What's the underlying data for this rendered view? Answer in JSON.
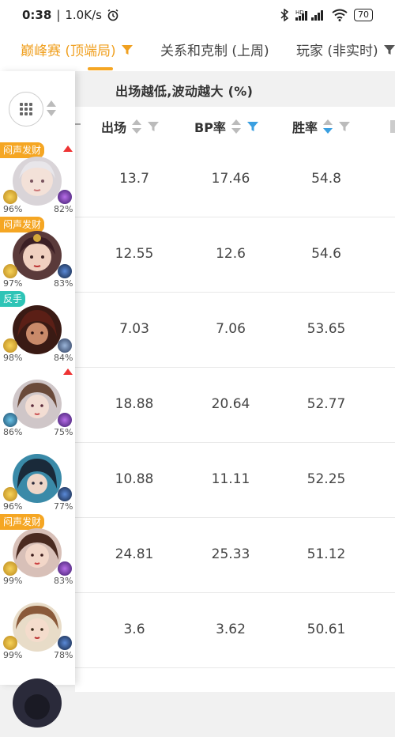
{
  "status": {
    "time": "0:38",
    "speed": "1.0K/s",
    "battery": "70"
  },
  "tabs": [
    {
      "label": "巅峰赛 (顶端局)",
      "active": true
    },
    {
      "label": "关系和克制 (上周)",
      "active": false
    },
    {
      "label": "玩家 (非实时)",
      "active": false
    }
  ],
  "table": {
    "note": "出场越低,波动越大 (%)",
    "columns": [
      {
        "label": "出场",
        "sort": "none",
        "filter_active": false
      },
      {
        "label": "BP率",
        "sort": "none",
        "filter_active": true
      },
      {
        "label": "胜率",
        "sort": "desc",
        "filter_active": false
      }
    ],
    "rows": [
      {
        "tag": "闷声发财",
        "tag_color": "#f5a623",
        "trend_up": true,
        "pct_left": "96%",
        "pct_right": "82%",
        "appear": "13.7",
        "bp": "17.46",
        "win": "54.8"
      },
      {
        "tag": "闷声发财",
        "tag_color": "#f5a623",
        "trend_up": false,
        "pct_left": "97%",
        "pct_right": "83%",
        "appear": "12.55",
        "bp": "12.6",
        "win": "54.6"
      },
      {
        "tag": "反手",
        "tag_color": "#2ec4b6",
        "trend_up": false,
        "pct_left": "98%",
        "pct_right": "84%",
        "appear": "7.03",
        "bp": "7.06",
        "win": "53.65"
      },
      {
        "tag": "",
        "tag_color": "",
        "trend_up": true,
        "pct_left": "86%",
        "pct_right": "75%",
        "appear": "18.88",
        "bp": "20.64",
        "win": "52.77"
      },
      {
        "tag": "",
        "tag_color": "",
        "trend_up": false,
        "pct_left": "96%",
        "pct_right": "77%",
        "appear": "10.88",
        "bp": "11.11",
        "win": "52.25"
      },
      {
        "tag": "闷声发财",
        "tag_color": "#f5a623",
        "trend_up": false,
        "pct_left": "99%",
        "pct_right": "83%",
        "appear": "24.81",
        "bp": "25.33",
        "win": "51.12"
      },
      {
        "tag": "",
        "tag_color": "",
        "trend_up": false,
        "pct_left": "99%",
        "pct_right": "78%",
        "appear": "3.6",
        "bp": "3.62",
        "win": "50.61"
      }
    ]
  },
  "colors": {
    "accent": "#f5a623",
    "filter_active": "#3a9fe0",
    "tag_orange": "#f5a623",
    "tag_teal": "#2ec4b6"
  }
}
